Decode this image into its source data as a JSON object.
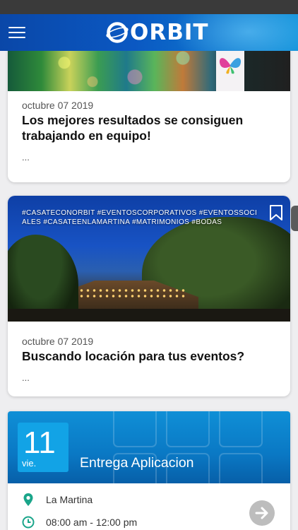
{
  "app": {
    "brand": "ORBIT"
  },
  "posts": [
    {
      "date": "octubre 07 2019",
      "title": "Los mejores resultados se consiguen trabajando en equipo!",
      "excerpt": "..."
    },
    {
      "tags": "#CASATECONORBIT #EVENTOSCORPORATIVOS #EVENTOSSOCIALES #CASATEENLAMARTINA #MATRIMONIOS #BODAS",
      "date": "octubre 07 2019",
      "title": "Buscando locación para tus eventos?",
      "excerpt": "..."
    }
  ],
  "event": {
    "day": "11",
    "weekday": "vie.",
    "title": "Entrega Aplicacion",
    "location": "La Martina",
    "time": "08:00 am - 12:00 pm"
  },
  "colors": {
    "accent": "#0b58c2",
    "event_banner": "#0a78c4",
    "location_icon": "#1aa58a"
  },
  "icons": [
    "menu-icon",
    "bookmark-icon",
    "location-pin-icon",
    "clock-icon",
    "arrow-right-icon"
  ]
}
